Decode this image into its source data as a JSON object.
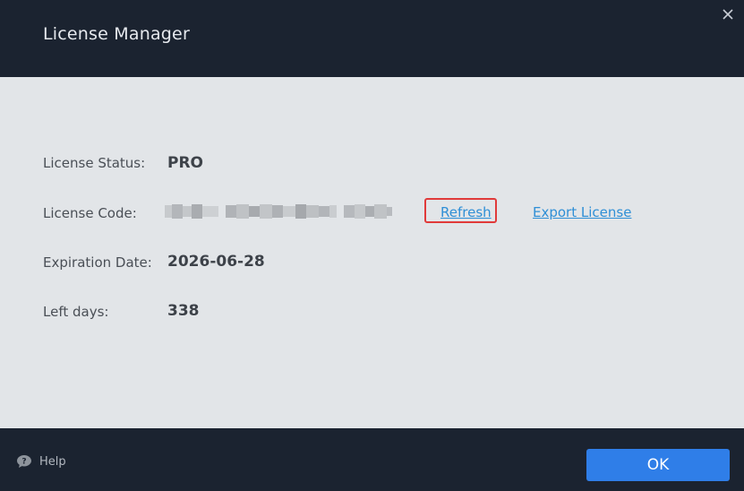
{
  "window": {
    "title": "License Manager"
  },
  "license": {
    "status_label": "License Status:",
    "status_value": "PRO",
    "code_label": "License Code:",
    "refresh_link": "Refresh",
    "export_link": "Export License",
    "expiration_label": "Expiration Date:",
    "expiration_value": "2026-06-28",
    "left_days_label": "Left days:",
    "left_days_value": "338"
  },
  "footer": {
    "help_label": "Help",
    "ok_label": "OK"
  },
  "colors": {
    "title_bar": "#1b2330",
    "content_bg": "#e2e5e8",
    "link": "#2f8fd6",
    "highlight_border": "#e03a3a",
    "primary_button": "#2f7ee8"
  }
}
